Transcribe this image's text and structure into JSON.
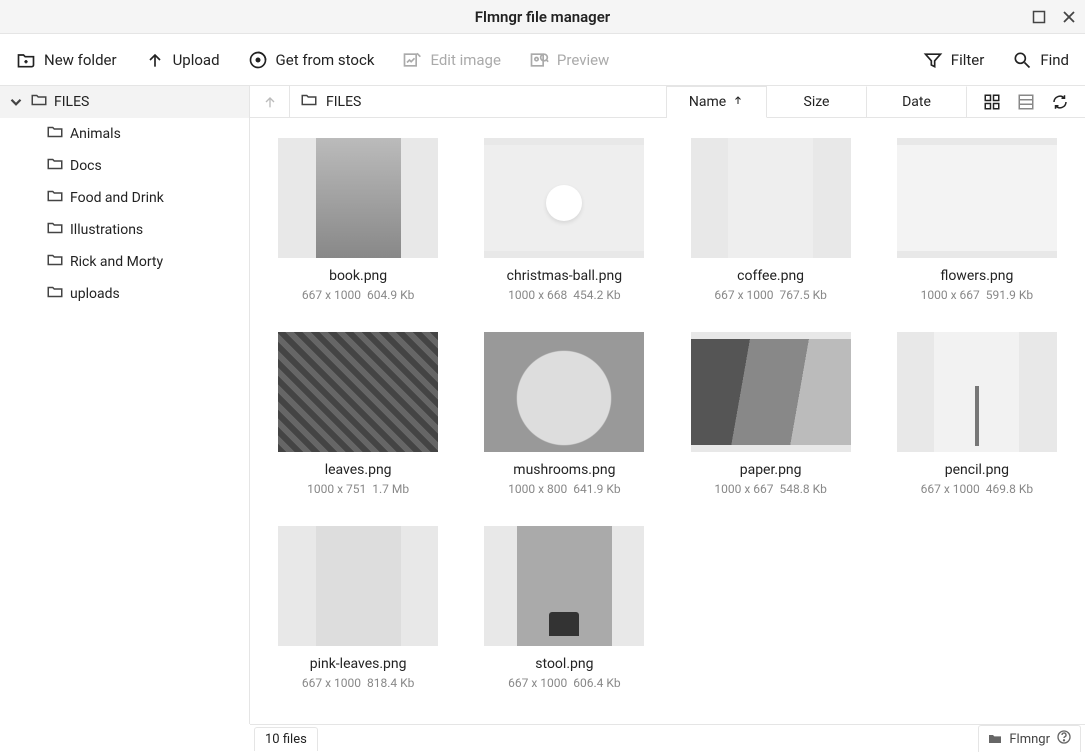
{
  "window": {
    "title": "Flmngr file manager"
  },
  "toolbar": {
    "new_folder": "New folder",
    "upload": "Upload",
    "get_from_stock": "Get from stock",
    "edit_image": "Edit image",
    "preview": "Preview",
    "filter": "Filter",
    "find": "Find"
  },
  "sidebar": {
    "root": {
      "label": "FILES"
    },
    "items": [
      {
        "label": "Animals"
      },
      {
        "label": "Docs"
      },
      {
        "label": "Food and Drink"
      },
      {
        "label": "Illustrations"
      },
      {
        "label": "Rick and Morty"
      },
      {
        "label": "uploads"
      }
    ]
  },
  "breadcrumb": {
    "current": "FILES"
  },
  "sort": {
    "name": "Name",
    "size": "Size",
    "date": "Date",
    "active": "Name",
    "direction": "asc"
  },
  "files": [
    {
      "name": "book.png",
      "dims": "667 x 1000",
      "size": "604.9 Kb",
      "thumb": "t-book"
    },
    {
      "name": "christmas-ball.png",
      "dims": "1000 x 668",
      "size": "454.2 Kb",
      "thumb": "t-ball"
    },
    {
      "name": "coffee.png",
      "dims": "667 x 1000",
      "size": "767.5 Kb",
      "thumb": "t-coffee"
    },
    {
      "name": "flowers.png",
      "dims": "1000 x 667",
      "size": "591.9 Kb",
      "thumb": "t-flowers"
    },
    {
      "name": "leaves.png",
      "dims": "1000 x 751",
      "size": "1.7 Mb",
      "thumb": "t-leaves"
    },
    {
      "name": "mushrooms.png",
      "dims": "1000 x 800",
      "size": "641.9 Kb",
      "thumb": "t-mush"
    },
    {
      "name": "paper.png",
      "dims": "1000 x 667",
      "size": "548.8 Kb",
      "thumb": "t-paper"
    },
    {
      "name": "pencil.png",
      "dims": "667 x 1000",
      "size": "469.8 Kb",
      "thumb": "t-pencil"
    },
    {
      "name": "pink-leaves.png",
      "dims": "667 x 1000",
      "size": "818.4 Kb",
      "thumb": "t-pink"
    },
    {
      "name": "stool.png",
      "dims": "667 x 1000",
      "size": "606.4 Kb",
      "thumb": "t-stool"
    }
  ],
  "status": {
    "count": "10 files",
    "brand": "Flmngr"
  }
}
